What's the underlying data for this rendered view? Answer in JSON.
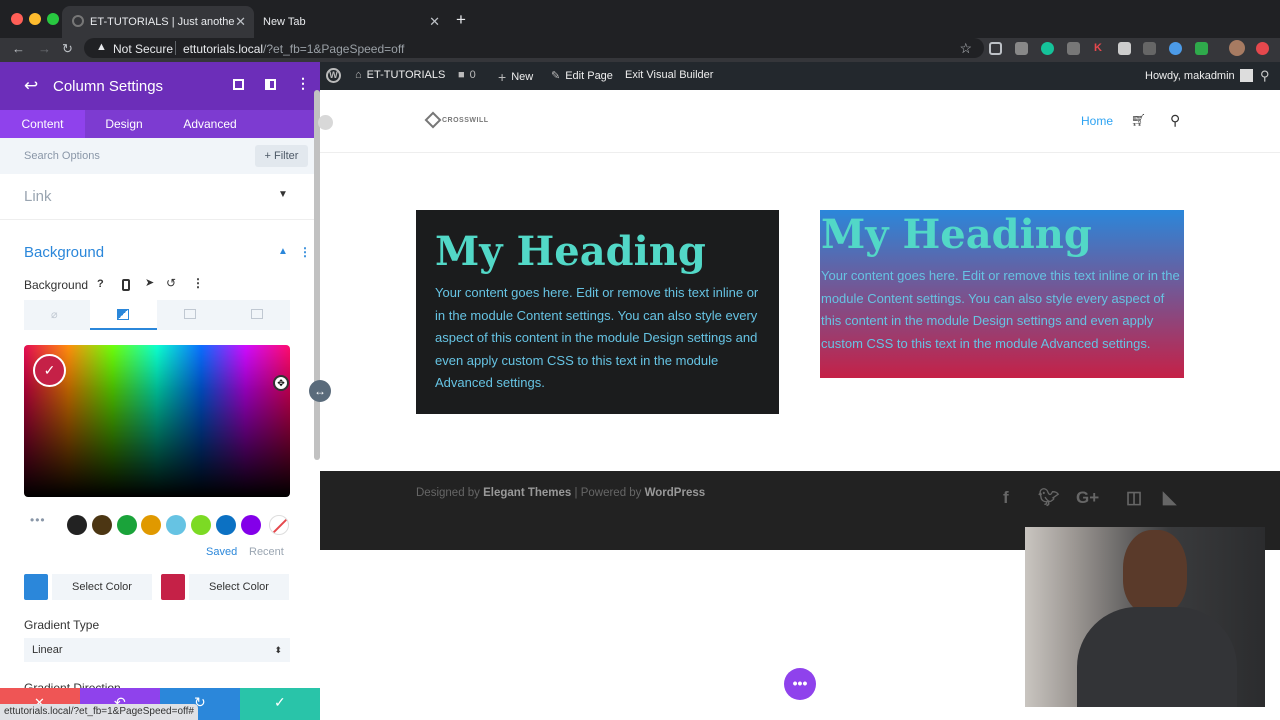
{
  "browser": {
    "active_tab_title": "ET-TUTORIALS | Just another W",
    "new_tab_title": "New Tab",
    "security_label": "Not Secure",
    "url_host": "ettutorials.local",
    "url_path": "/?et_fb=1&PageSpeed=off",
    "status_url": "ettutorials.local/?et_fb=1&PageSpeed=off#"
  },
  "wp_admin_bar": {
    "site_name": "ET-TUTORIALS",
    "comments_count": "0",
    "new_label": "New",
    "edit_page_label": "Edit Page",
    "exit_builder_label": "Exit Visual Builder",
    "howdy_label": "Howdy, makadmin"
  },
  "panel": {
    "title": "Column Settings",
    "tabs": [
      "Content",
      "Design",
      "Advanced"
    ],
    "search_placeholder": "Search Options",
    "filter_label": "Filter",
    "link_section": "Link",
    "background_section": "Background",
    "background_label": "Background",
    "help_icon": "?",
    "saved_label": "Saved",
    "recent_label": "Recent",
    "select_color_1": "Select Color",
    "select_color_2": "Select Color",
    "gradient_type_label": "Gradient Type",
    "gradient_type_value": "Linear",
    "gradient_direction_label": "Gradient Direction",
    "color_start": "#2b87da",
    "color_end": "#c52147",
    "swatch_colors": [
      "#222222",
      "#4c3613",
      "#1aa33a",
      "#e09900",
      "#66c3e3",
      "#7cda24",
      "#0c71c3",
      "#8300e9"
    ]
  },
  "site": {
    "logo_text": "CROSSWILL",
    "nav_home": "Home"
  },
  "modules": {
    "left_heading": "My Heading",
    "left_body": "Your content goes here. Edit or remove this text inline or in the module Content settings. You can also style every aspect of this content in the module Design settings and even apply custom CSS to this text in the module Advanced settings.",
    "right_heading": "My Heading",
    "right_body": "Your content goes here. Edit or remove this text inline or in the module Content settings. You can also style every aspect of this content in the module Design settings and even apply custom CSS to this text in the module Advanced settings."
  },
  "footer": {
    "designed_by": "Designed by ",
    "elegant": "Elegant Themes",
    "powered_by": " | Powered by ",
    "wordpress": "WordPress"
  },
  "colors": {
    "accent_purple": "#7d3bd1",
    "heading_teal": "#52d8c7",
    "accent_blue": "#2ea3f2"
  }
}
